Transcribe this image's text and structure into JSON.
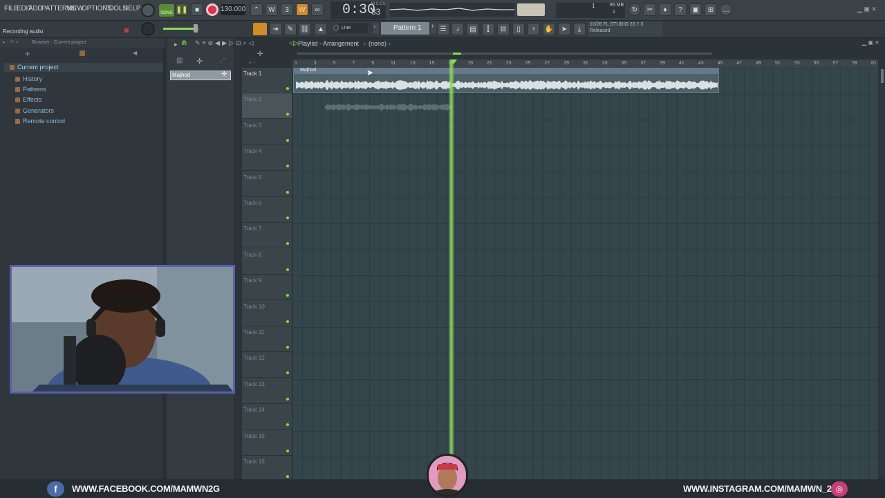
{
  "menu": [
    "FILE",
    "EDIT",
    "ADD",
    "PATTERNS",
    "VIEW",
    "OPTIONS",
    "TOOLS",
    "HELP"
  ],
  "transport": {
    "song_label": "SONG",
    "tempo": "130.000",
    "time": "0:30",
    "time_sub": "83",
    "time_unit": "M:S:CS"
  },
  "hint_bar": "Recording audio",
  "cpu": {
    "value": "1",
    "mem": "85 MB",
    "voices": "1"
  },
  "snap": "Line",
  "pattern_selector": "Pattern 1",
  "news": {
    "line1": "10/26  FL STUDIO 20.7.3",
    "line2": "Released"
  },
  "browser": {
    "header": "Browser - Current project",
    "root": "Current project",
    "items": [
      "History",
      "Patterns",
      "Effects",
      "Generators",
      "Remote control"
    ]
  },
  "playlist": {
    "title": "Playlist - Arrangement",
    "arrangement": "(none)",
    "picker_item": "Majhod",
    "clip_name": "Majhod",
    "tracks": [
      "Track 1",
      "Track 2",
      "Track 3",
      "Track 4",
      "Track 5",
      "Track 6",
      "Track 7",
      "Track 8",
      "Track 9",
      "Track 10",
      "Track 11",
      "Track 12",
      "Track 13",
      "Track 14",
      "Track 15",
      "Track 16"
    ],
    "ruler": [
      "1",
      "3",
      "5",
      "7",
      "9",
      "11",
      "13",
      "15",
      "17",
      "19",
      "21",
      "23",
      "25",
      "27",
      "29",
      "31",
      "33",
      "35",
      "37",
      "39",
      "41",
      "43",
      "45",
      "47",
      "49",
      "51",
      "53",
      "55",
      "57",
      "59",
      "61"
    ],
    "playhead_bar": 17.5
  },
  "social": {
    "facebook": "WWW.FACEBOOK.COM/MAMWN2G",
    "instagram": "WWW.INSTAGRAM.COM/MAMWN_2G"
  },
  "colors": {
    "accent": "#8bdc57",
    "record": "#e0314b",
    "brand_frame": "#5b60a8"
  }
}
